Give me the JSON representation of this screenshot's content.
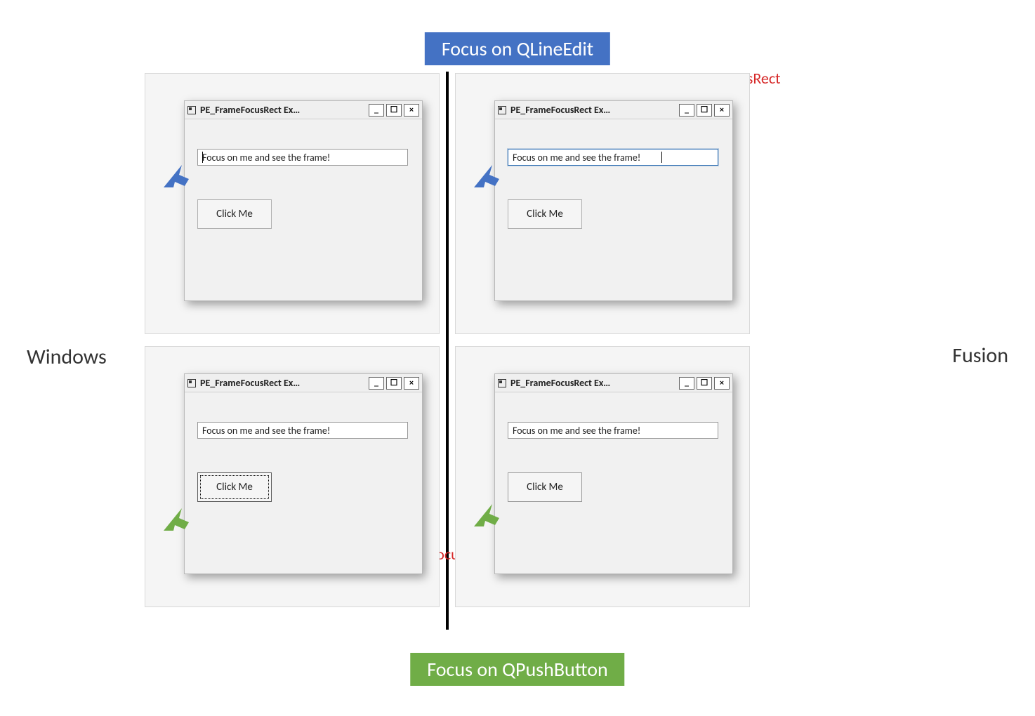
{
  "banners": {
    "top": "Focus on QLineEdit",
    "bottom": "Focus on QPushButton"
  },
  "sideLabels": {
    "left": "Windows",
    "right": "Fusion"
  },
  "annotations": {
    "top": "PE_FrameFocusRect",
    "bottom": "PE_FrameFocusRect"
  },
  "window": {
    "title": "PE_FrameFocusRect Ex…",
    "minimizeGlyph": "_",
    "maximizeGlyph": "☐",
    "closeGlyph": "×",
    "lineedit_text": "Focus on me and see the frame!",
    "button_text": "Click Me"
  },
  "arrows": {
    "blue": "pointer-arrow-blue",
    "green": "pointer-arrow-green"
  }
}
